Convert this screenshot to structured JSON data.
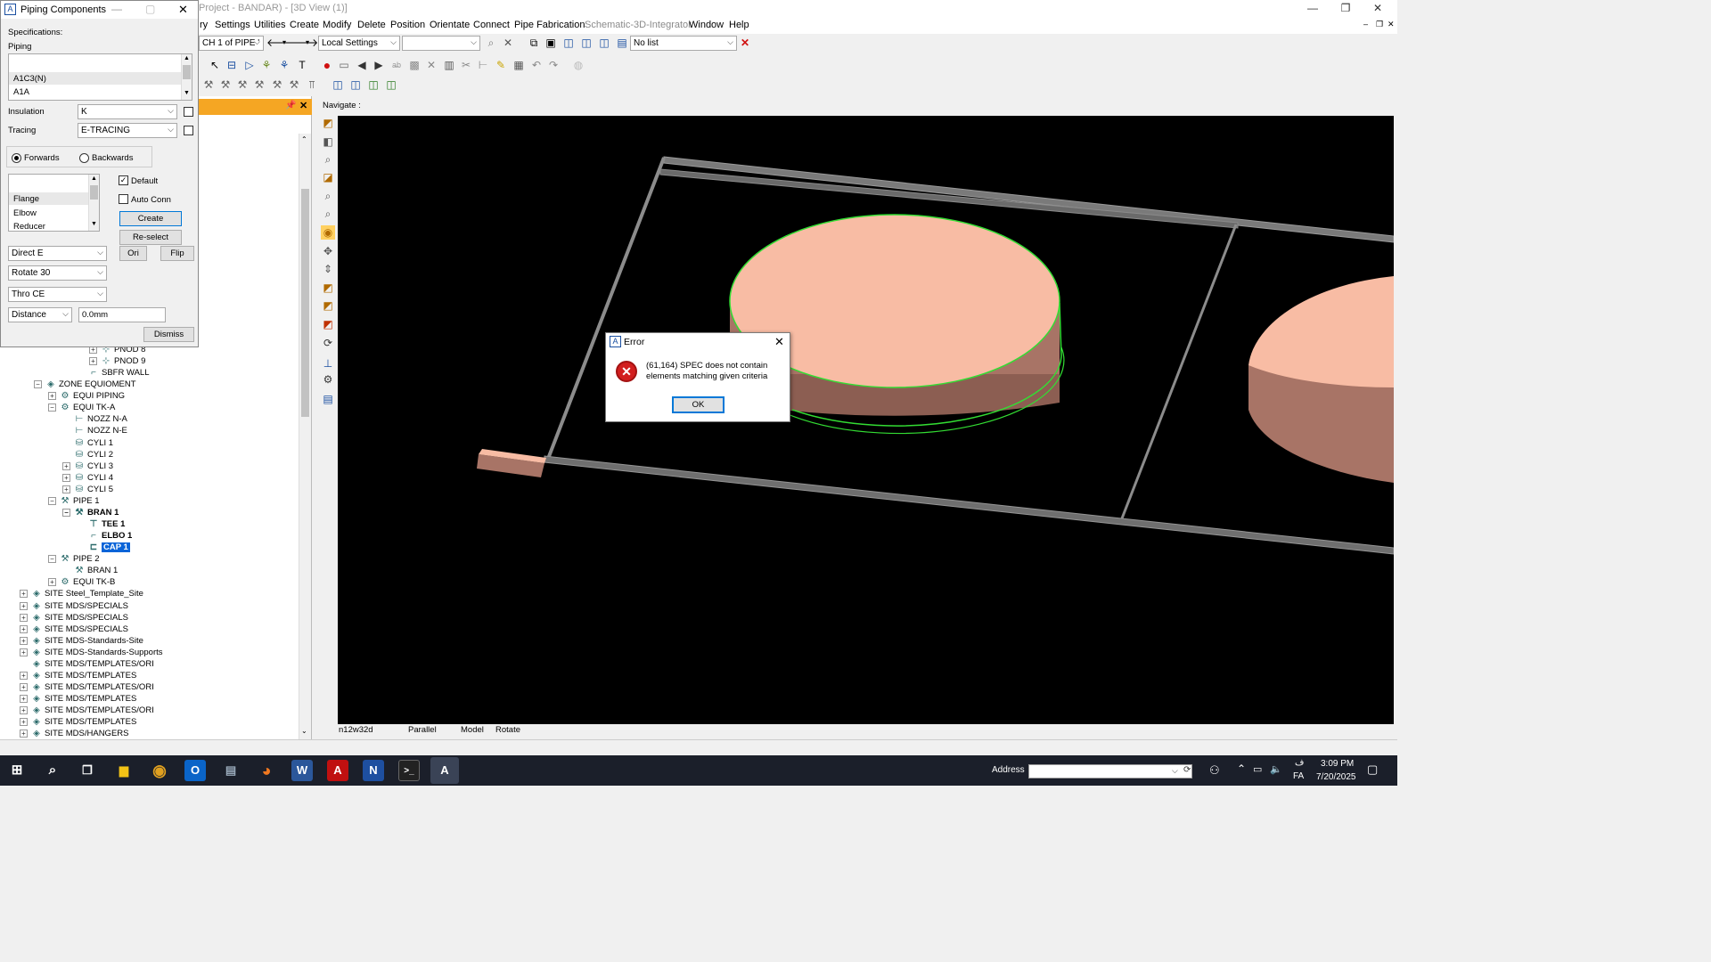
{
  "window": {
    "title": "Project - BANDAR) - [3D View (1)]",
    "minimize": "—",
    "maximize": "❐",
    "close": "✕"
  },
  "menu": [
    "ry",
    "Settings",
    "Utilities",
    "Create",
    "Modify",
    "Delete",
    "Position",
    "Orientate",
    "Connect",
    "Pipe Fabrication",
    "Schematic-3D-Integrator",
    "Window",
    "Help"
  ],
  "menu_disabled": [
    "Schematic-3D-Integrator"
  ],
  "toolbar": {
    "branch_combo": "CH 1 of PIPE '",
    "settings_combo": "Local Settings",
    "empty_combo": "",
    "list_combo": "No list"
  },
  "navigate": {
    "label": "Navigate :"
  },
  "view_status": {
    "coord": "n12w32d",
    "projection": "Parallel",
    "mode": "Model",
    "action": "Rotate"
  },
  "piping_dialog": {
    "title": "Piping Components",
    "specifications_label": "Specifications:",
    "piping_label": "Piping",
    "spec_items": [
      "A1C3(N)",
      "A1A"
    ],
    "insulation_label": "Insulation",
    "insulation_value": "K",
    "tracing_label": "Tracing",
    "tracing_value": "E-TRACING",
    "forwards_label": "Forwards",
    "backwards_label": "Backwards",
    "component_items": [
      "Flange",
      "Elbow",
      "Reducer"
    ],
    "default_label": "Default",
    "default_checked": true,
    "autoconn_label": "Auto Conn",
    "create_label": "Create",
    "reselect_label": "Re-select",
    "ori_label": "Ori",
    "flip_label": "Flip",
    "direct_value": "Direct E",
    "rotate_value": "Rotate 30",
    "thro_value": "Thro CE",
    "distance_value": "Distance",
    "distance_input": "0.0mm",
    "dismiss_label": "Dismiss"
  },
  "tree": [
    {
      "label": "PNOD 8",
      "indent": 100,
      "expander": "+",
      "icon": "pnod",
      "bold": false
    },
    {
      "label": "PNOD 9",
      "indent": 100,
      "expander": "+",
      "icon": "pnod",
      "bold": false
    },
    {
      "label": "SBFR WALL",
      "indent": 86,
      "expander": "",
      "icon": "sbfr",
      "bold": false
    },
    {
      "label": "ZONE EQUIOMENT",
      "indent": 38,
      "expander": "−",
      "icon": "zone",
      "bold": false
    },
    {
      "label": "EQUI PIPING",
      "indent": 54,
      "expander": "+",
      "icon": "equi",
      "bold": false
    },
    {
      "label": "EQUI TK-A",
      "indent": 54,
      "expander": "−",
      "icon": "equi",
      "bold": false
    },
    {
      "label": "NOZZ N-A",
      "indent": 70,
      "expander": "",
      "icon": "nozz",
      "bold": false
    },
    {
      "label": "NOZZ N-E",
      "indent": 70,
      "expander": "",
      "icon": "nozz",
      "bold": false
    },
    {
      "label": "CYLI 1",
      "indent": 70,
      "expander": "",
      "icon": "cyli",
      "bold": false
    },
    {
      "label": "CYLI 2",
      "indent": 70,
      "expander": "",
      "icon": "cyli",
      "bold": false
    },
    {
      "label": "CYLI 3",
      "indent": 70,
      "expander": "+",
      "icon": "cyli",
      "bold": false
    },
    {
      "label": "CYLI 4",
      "indent": 70,
      "expander": "+",
      "icon": "cyli",
      "bold": false
    },
    {
      "label": "CYLI 5",
      "indent": 70,
      "expander": "+",
      "icon": "cyli",
      "bold": false
    },
    {
      "label": "PIPE 1",
      "indent": 54,
      "expander": "−",
      "icon": "pipe",
      "bold": false
    },
    {
      "label": "BRAN 1",
      "indent": 70,
      "expander": "−",
      "icon": "bran",
      "bold": true
    },
    {
      "label": "TEE 1",
      "indent": 86,
      "expander": "",
      "icon": "tee",
      "bold": true
    },
    {
      "label": "ELBO 1",
      "indent": 86,
      "expander": "",
      "icon": "elbo",
      "bold": true
    },
    {
      "label": "CAP 1",
      "indent": 86,
      "expander": "",
      "icon": "cap",
      "bold": true,
      "selected": true
    },
    {
      "label": "PIPE 2",
      "indent": 54,
      "expander": "−",
      "icon": "pipe",
      "bold": false
    },
    {
      "label": "BRAN 1",
      "indent": 70,
      "expander": "",
      "icon": "bran",
      "bold": false
    },
    {
      "label": "EQUI TK-B",
      "indent": 54,
      "expander": "+",
      "icon": "equi",
      "bold": false
    },
    {
      "label": "SITE Steel_Template_Site",
      "indent": 22,
      "expander": "+",
      "icon": "site",
      "bold": false
    },
    {
      "label": "SITE MDS/SPECIALS",
      "indent": 22,
      "expander": "+",
      "icon": "site",
      "bold": false
    },
    {
      "label": "SITE MDS/SPECIALS",
      "indent": 22,
      "expander": "+",
      "icon": "site",
      "bold": false
    },
    {
      "label": "SITE MDS/SPECIALS",
      "indent": 22,
      "expander": "+",
      "icon": "site",
      "bold": false
    },
    {
      "label": "SITE MDS-Standards-Site",
      "indent": 22,
      "expander": "+",
      "icon": "site",
      "bold": false
    },
    {
      "label": "SITE MDS-Standards-Supports",
      "indent": 22,
      "expander": "+",
      "icon": "site",
      "bold": false
    },
    {
      "label": "SITE MDS/TEMPLATES/ORI",
      "indent": 22,
      "expander": "",
      "icon": "site",
      "bold": false
    },
    {
      "label": "SITE MDS/TEMPLATES",
      "indent": 22,
      "expander": "+",
      "icon": "site",
      "bold": false
    },
    {
      "label": "SITE MDS/TEMPLATES/ORI",
      "indent": 22,
      "expander": "+",
      "icon": "site",
      "bold": false
    },
    {
      "label": "SITE MDS/TEMPLATES",
      "indent": 22,
      "expander": "+",
      "icon": "site",
      "bold": false
    },
    {
      "label": "SITE MDS/TEMPLATES/ORI",
      "indent": 22,
      "expander": "+",
      "icon": "site",
      "bold": false
    },
    {
      "label": "SITE MDS/TEMPLATES",
      "indent": 22,
      "expander": "+",
      "icon": "site",
      "bold": false
    },
    {
      "label": "SITE MDS/HANGERS",
      "indent": 22,
      "expander": "+",
      "icon": "site",
      "bold": false
    }
  ],
  "error_dialog": {
    "title": "Error",
    "message": "(61,164)  SPEC does not contain elements matching given criteria",
    "ok_label": "OK"
  },
  "taskbar": {
    "address_label": "Address",
    "lang": "FA",
    "lang_script": "ف",
    "time": "3:09 PM",
    "date": "7/20/2025"
  },
  "colors": {
    "tank_top": "#f8bca4",
    "tank_side": "#a87466",
    "selection_green": "#33dd33",
    "frame_gray": "#8c8c8c",
    "explorer_header": "#f5a623",
    "select_blue": "#0a64d8"
  }
}
